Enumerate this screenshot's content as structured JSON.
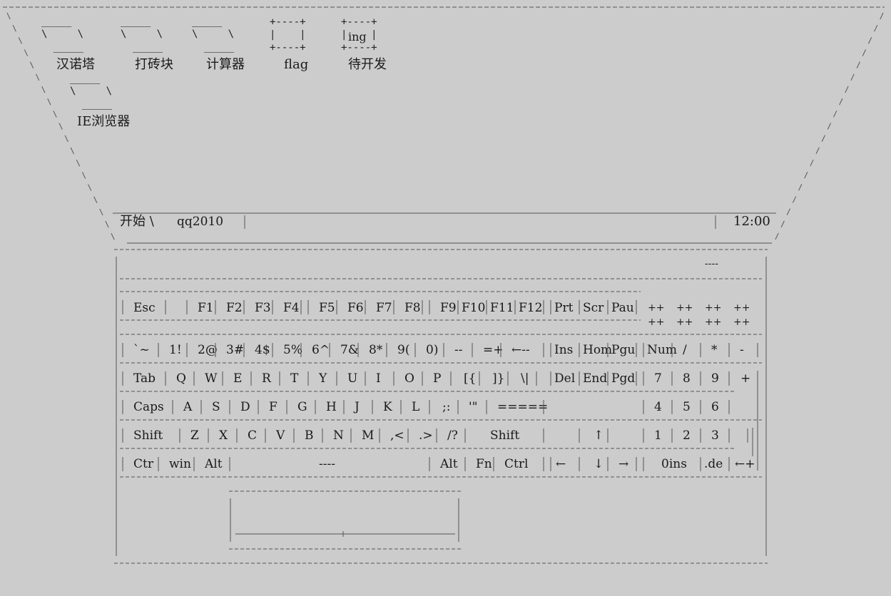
{
  "desktop": {
    "icons": [
      {
        "label": "汉诺塔"
      },
      {
        "label": "打砖块"
      },
      {
        "label": "计算器"
      },
      {
        "label": "flag"
      },
      {
        "label": "待开发",
        "box_text": "ing"
      },
      {
        "label": "IE浏览器"
      }
    ]
  },
  "taskbar": {
    "start_label": "开始 \\",
    "task_label": "qq2010",
    "clock": "12:00"
  },
  "keyboard": {
    "fn_row": [
      "Esc",
      "F1",
      "F2",
      "F3",
      "F4",
      "F5",
      "F6",
      "F7",
      "F8",
      "F9",
      "F10",
      "F11",
      "F12",
      "Prt",
      "Scr",
      "Pau"
    ],
    "fn_plus": [
      "++",
      "++",
      "++",
      "++"
    ],
    "num_row": [
      "`~",
      "1!",
      "2@",
      "3#",
      "4$",
      "5%",
      "6^",
      "7&",
      "8*",
      "9(",
      "0)",
      "--",
      "=+",
      "←--",
      "Ins",
      "Hom",
      "Pgu",
      "Num",
      "/",
      "*",
      "-"
    ],
    "tab_row": [
      "Tab",
      "Q",
      "W",
      "E",
      "R",
      "T",
      "Y",
      "U",
      "I",
      "O",
      "P",
      "[{",
      "]}",
      "\\|",
      "Del",
      "End",
      "Pgd",
      "7",
      "8",
      "9",
      "+"
    ],
    "caps_row": [
      "Caps",
      "A",
      "S",
      "D",
      "F",
      "G",
      "H",
      "J",
      "K",
      "L",
      ";:",
      "'\"",
      "=====",
      "4",
      "5",
      "6"
    ],
    "shift_row": [
      "Shift",
      "Z",
      "X",
      "C",
      "V",
      "B",
      "N",
      "M",
      ",<",
      ".>",
      "/?",
      "Shift",
      "↑",
      "1",
      "2",
      "3"
    ],
    "ctrl_row": [
      "Ctr",
      "win",
      "Alt",
      "----",
      "Alt",
      "Fn",
      "Ctrl",
      "←",
      "↓",
      "→",
      "0ins",
      ".de",
      "←+"
    ],
    "indicator": "----"
  }
}
